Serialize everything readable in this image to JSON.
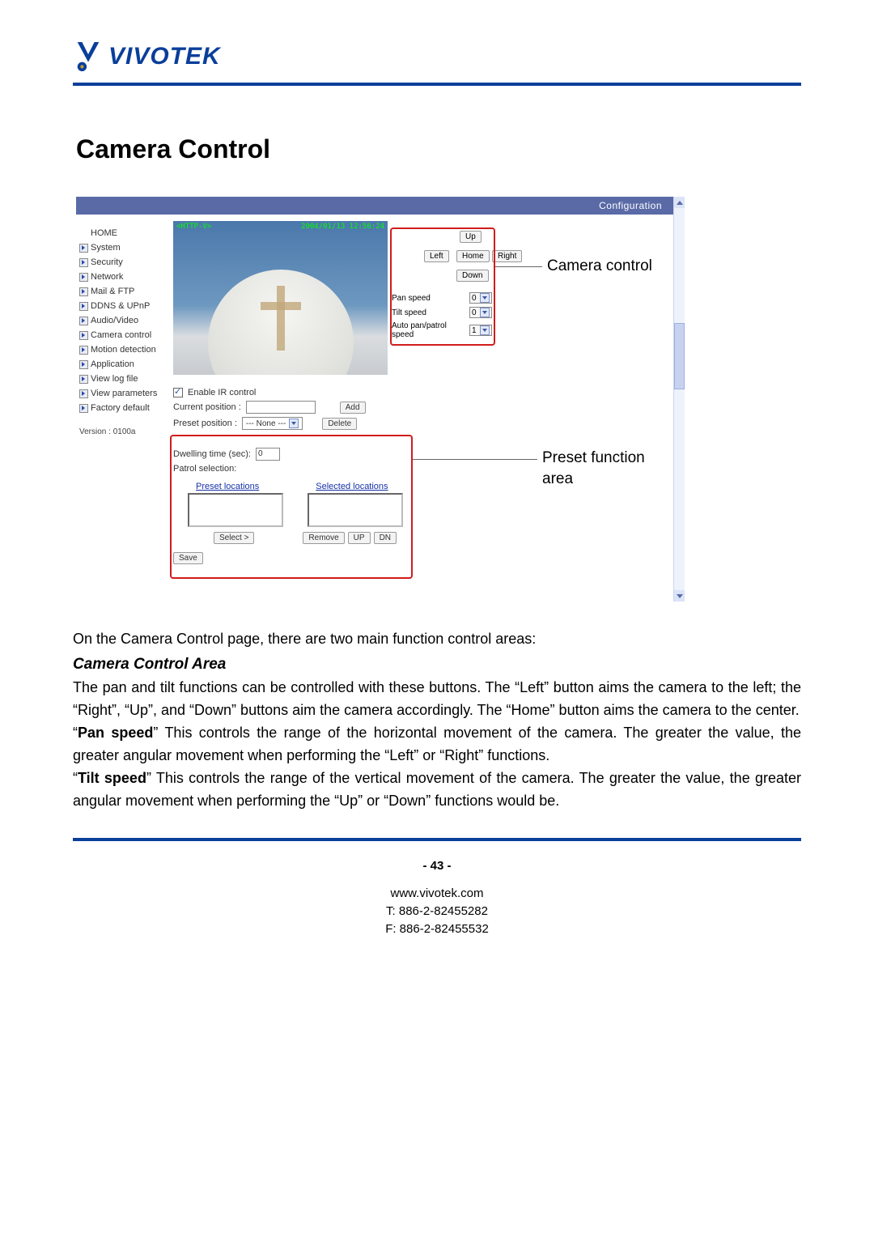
{
  "logo": {
    "text": "VIVOTEK"
  },
  "title": "Camera Control",
  "shot": {
    "headerLink": "Configuration",
    "camera": {
      "overlayLeft": "<HTTP-V>",
      "overlayRight": "2004/01/13 12:56:24"
    },
    "nav": {
      "home": "HOME",
      "items": [
        "System",
        "Security",
        "Network",
        "Mail & FTP",
        "DDNS & UPnP",
        "Audio/Video",
        "Camera control",
        "Motion detection",
        "Application",
        "View log file",
        "View parameters",
        "Factory default"
      ],
      "version": "Version : 0100a"
    },
    "dir": {
      "up": "Up",
      "left": "Left",
      "home": "Home",
      "right": "Right",
      "down": "Down"
    },
    "speed": {
      "panLabel": "Pan speed",
      "panValue": "0",
      "tiltLabel": "Tilt speed",
      "tiltValue": "0",
      "autoLabel": "Auto pan/patrol speed",
      "autoValue": "1"
    },
    "preset": {
      "enableIR": "Enable IR control",
      "currentPosLabel": "Current position :",
      "addBtn": "Add",
      "presetPosLabel": "Preset position :",
      "presetPosValue": "--- None ---",
      "deleteBtn": "Delete",
      "dwellLabel": "Dwelling time (sec):",
      "dwellValue": "0",
      "patrolLabel": "Patrol selection:",
      "presetLocHeader": "Preset locations",
      "selectedLocHeader": "Selected locations",
      "selectBtn": "Select >",
      "removeBtn": "Remove",
      "upBtn": "UP",
      "dnBtn": "DN",
      "saveBtn": "Save"
    },
    "callouts": {
      "cameraControl": "Camera control",
      "presetArea": "Preset function area"
    }
  },
  "doc": {
    "intro": "On the Camera Control page, there are two main function control areas:",
    "sub1": "Camera Control Area",
    "p1": "The pan and tilt functions can be controlled with these buttons. The “Left” button aims the camera to the left; the “Right”, “Up”, and “Down” buttons aim the camera accordingly. The “Home” button aims the camera to the center.",
    "p2a": "“",
    "p2bold": "Pan speed",
    "p2b": "” This controls the range of the horizontal movement of the camera. The greater the value, the greater angular movement when performing the “Left” or “Right” functions.",
    "p3a": "“",
    "p3bold": "Tilt speed",
    "p3b": "” This controls the range of the vertical movement of the camera. The greater the value, the greater angular movement when performing the “Up” or “Down” functions would be."
  },
  "footer": {
    "page": "- 43 -",
    "url": "www.vivotek.com",
    "tel": "T: 886-2-82455282",
    "fax": "F: 886-2-82455532"
  }
}
